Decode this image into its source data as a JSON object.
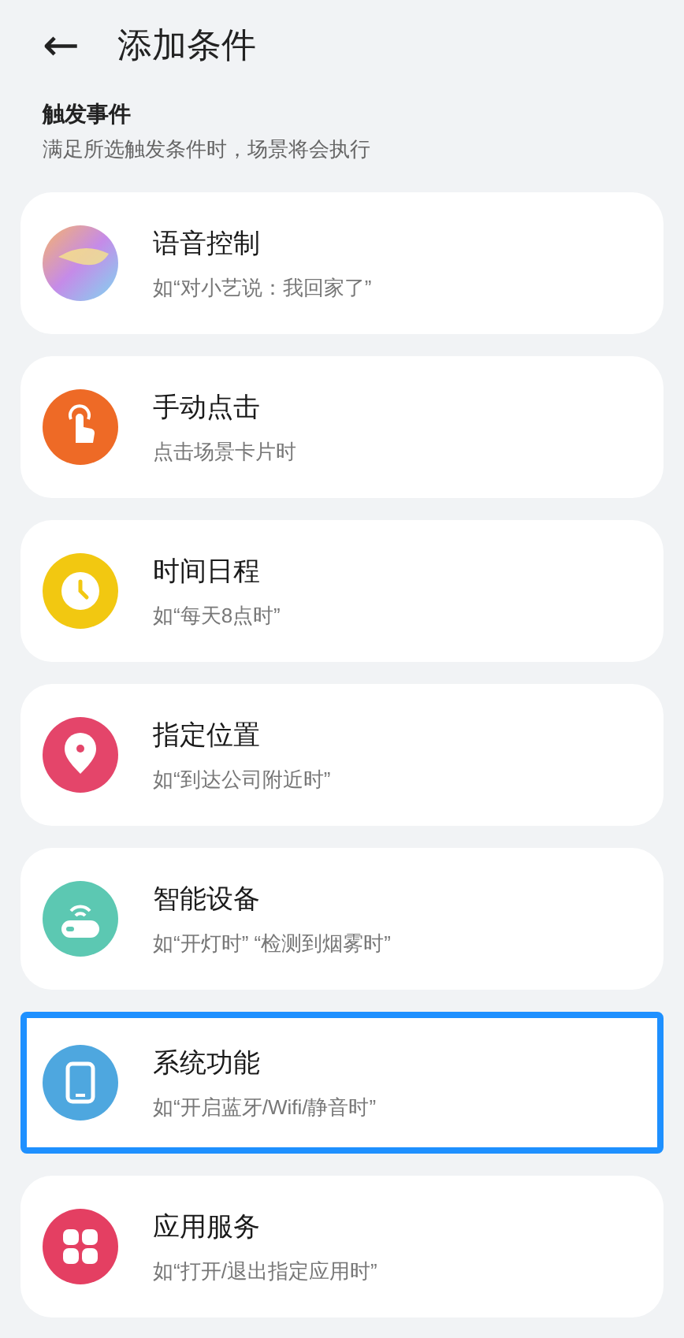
{
  "header": {
    "back": "←",
    "title": "添加条件"
  },
  "section": {
    "title": "触发事件",
    "subtitle": "满足所选触发条件时，场景将会执行"
  },
  "items": [
    {
      "kind": "voice",
      "color": "#c58be8",
      "title": "语音控制",
      "subtitle": "如“对小艺说：我回家了”",
      "selected": false
    },
    {
      "kind": "touch",
      "color": "#ee6a26",
      "title": "手动点击",
      "subtitle": "点击场景卡片时",
      "selected": false
    },
    {
      "kind": "clock",
      "color": "#f2c811",
      "title": "时间日程",
      "subtitle": "如“每天8点时”",
      "selected": false
    },
    {
      "kind": "location",
      "color": "#e4456a",
      "title": "指定位置",
      "subtitle": "如“到达公司附近时”",
      "selected": false
    },
    {
      "kind": "device",
      "color": "#5cc8b2",
      "title": "智能设备",
      "subtitle": "如“开灯时” “检测到烟雾时”",
      "selected": false
    },
    {
      "kind": "phone",
      "color": "#4ea7df",
      "title": "系统功能",
      "subtitle": "如“开启蓝牙/Wifi/静音时”",
      "selected": true
    },
    {
      "kind": "apps",
      "color": "#e43f62",
      "title": "应用服务",
      "subtitle": "如“打开/退出指定应用时”",
      "selected": false
    }
  ]
}
